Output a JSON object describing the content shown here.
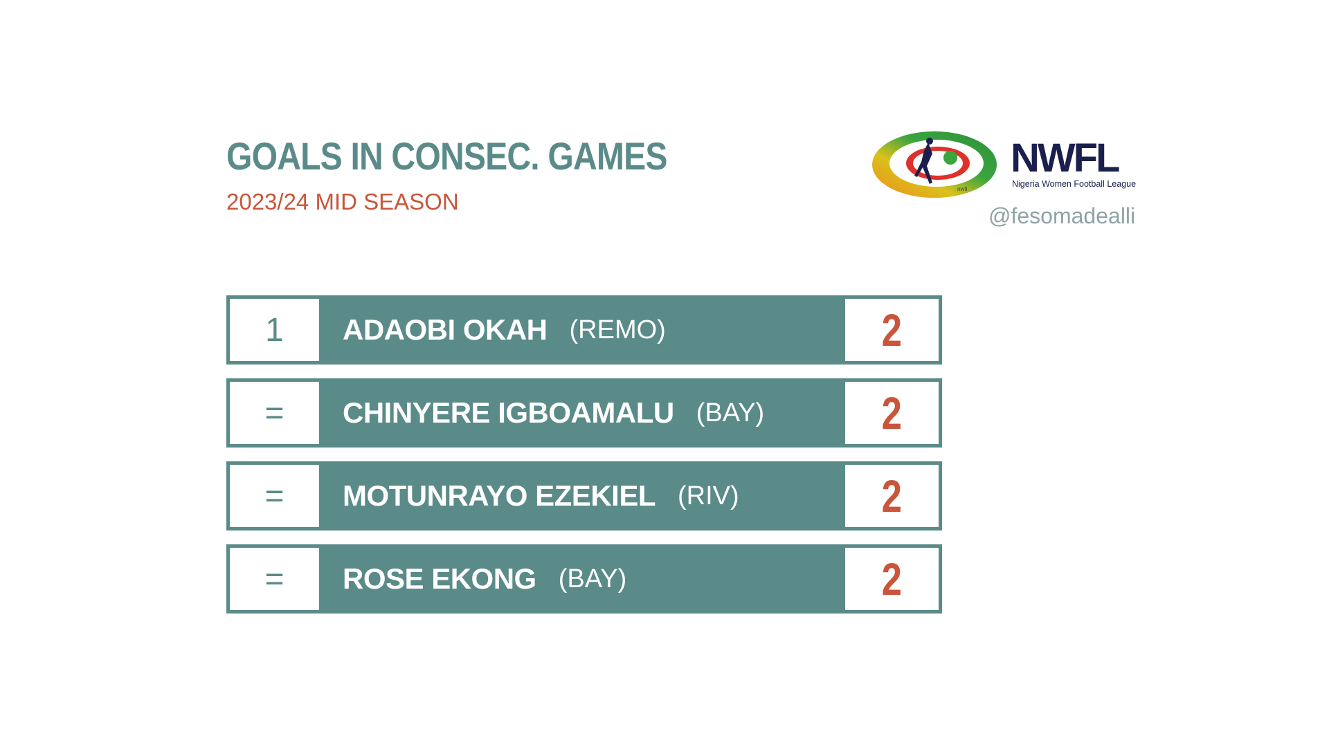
{
  "header": {
    "title": "GOALS IN CONSEC. GAMES",
    "subtitle": "2023/24 MID SEASON"
  },
  "logo": {
    "wordmark": "NWFL",
    "tagline": "Nigeria Women Football League",
    "emblem_text": "nwfl"
  },
  "handle": "@fesomadealli",
  "colors": {
    "teal": "#5a8b89",
    "accent": "#c9553a",
    "handle": "#8fa3a6",
    "logo_navy": "#1b1f4d",
    "logo_green": "#3aa43f",
    "logo_orange": "#f08a1c"
  },
  "rows": [
    {
      "rank": "1",
      "name": "ADAOBI OKAH",
      "team": "(REMO)",
      "value": "2"
    },
    {
      "rank": "=",
      "name": "CHINYERE IGBOAMALU",
      "team": "(BAY)",
      "value": "2"
    },
    {
      "rank": "=",
      "name": "MOTUNRAYO EZEKIEL",
      "team": "(RIV)",
      "value": "2"
    },
    {
      "rank": "=",
      "name": "ROSE EKONG",
      "team": "(BAY)",
      "value": "2"
    }
  ]
}
